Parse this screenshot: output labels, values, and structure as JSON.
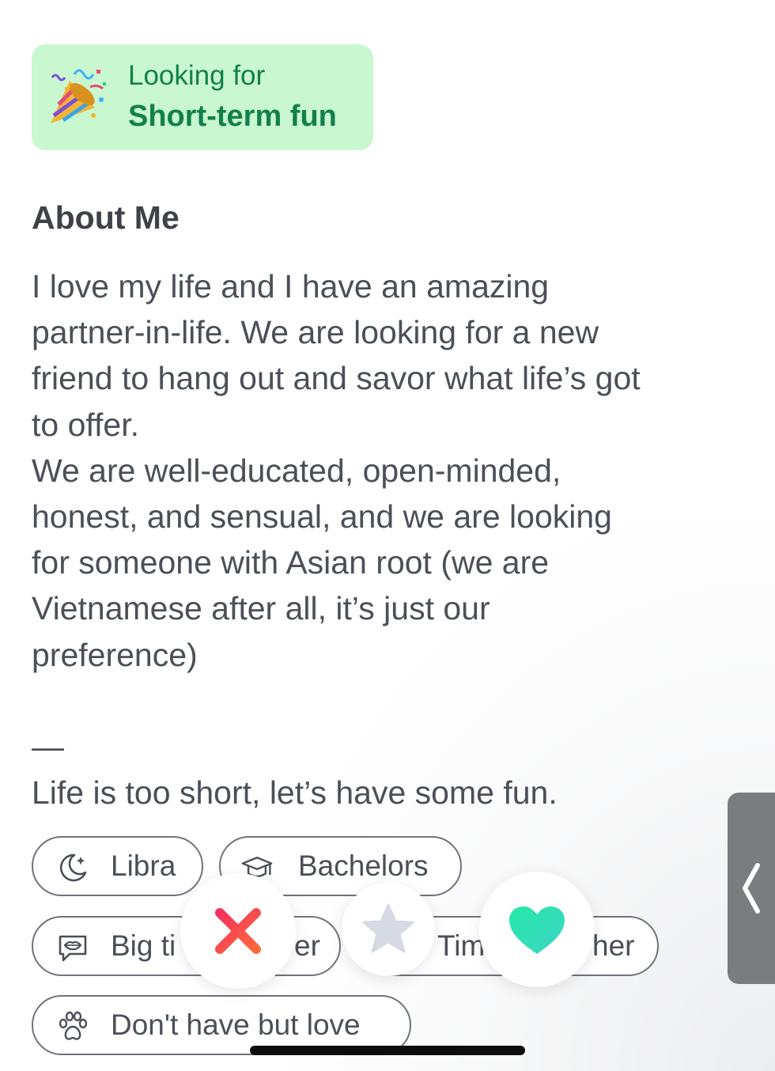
{
  "relationship_goal": {
    "caption": "Looking for",
    "value": "Short-term fun",
    "icon": "party-popper-icon"
  },
  "about": {
    "title": "About Me",
    "text": "I love my life and I have an amazing\npartner-in-life. We are looking for a new\nfriend to hang out and savor what life’s got\nto offer.\nWe are well-educated, open-minded,\nhonest, and sensual, and we are looking\nfor someone with Asian root (we are\nVietnamese after all, it’s just our\npreference)\n\n—\nLife is too short, let’s have some fun."
  },
  "tags": [
    {
      "label": "Libra",
      "icon": "moon-stars-icon"
    },
    {
      "label": "Bachelors",
      "icon": "graduation-cap-icon"
    },
    {
      "label": "Big ti",
      "icon": "lips-speech-icon"
    },
    {
      "label": "er",
      "icon": ""
    },
    {
      "label": "Tim",
      "icon": ""
    },
    {
      "label": "her",
      "icon": ""
    },
    {
      "label": "Don't have but love",
      "icon": "paw-icon"
    }
  ],
  "actions": {
    "nope_icon": "close-x-icon",
    "super_like_icon": "star-icon",
    "like_icon": "heart-icon"
  },
  "colors": {
    "goal_bg": "#c9f7cf",
    "goal_text": "#12804a",
    "nope": "#f23d52",
    "like": "#2ee3b0",
    "star": "#d6dae3"
  }
}
